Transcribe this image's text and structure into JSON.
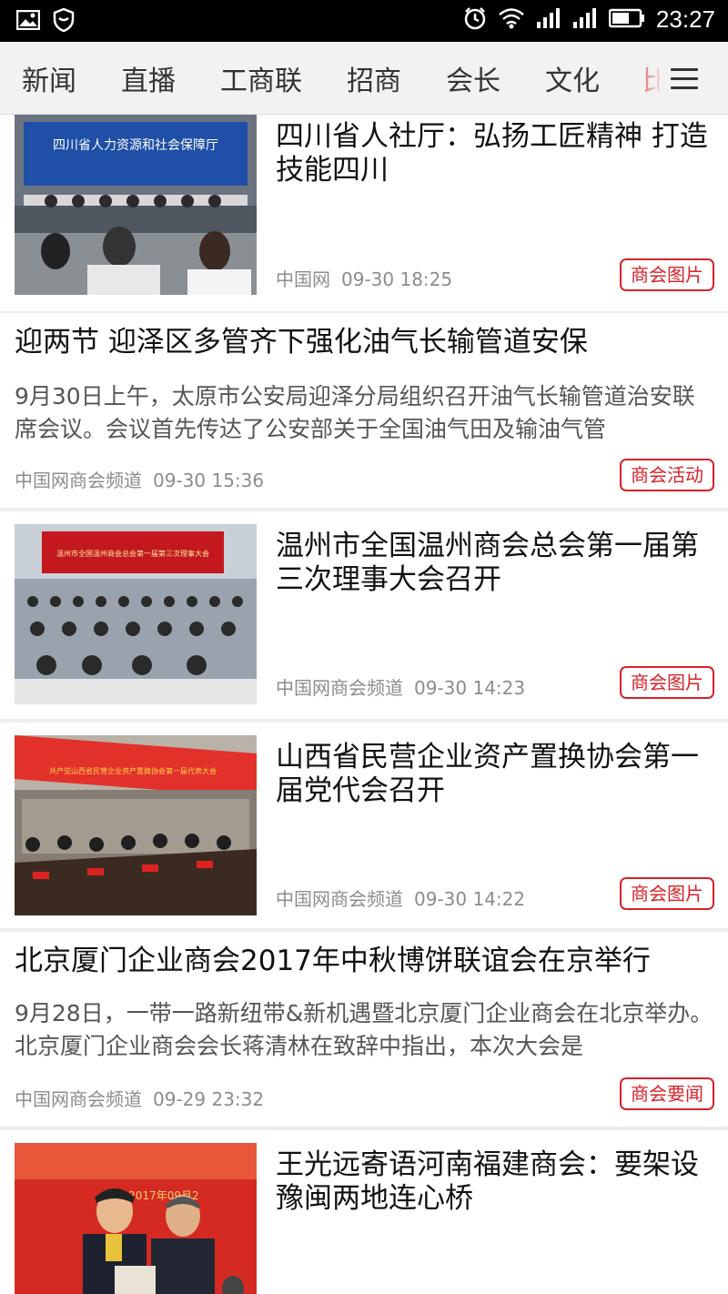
{
  "status_bar": {
    "time": "23:27",
    "icons": [
      "gallery-icon",
      "shield-icon",
      "alarm-icon",
      "wifi-icon",
      "signal-icon",
      "signal-icon",
      "battery-icon"
    ]
  },
  "nav": {
    "tabs": [
      "新闻",
      "直播",
      "工商联",
      "招商",
      "会长",
      "文化"
    ],
    "overflow_tab": "比",
    "menu_icon": "hamburger-menu-icon",
    "accent_color": "#d8222a"
  },
  "feed": [
    {
      "type": "image",
      "title": "四川省人社厅：弘扬工匠精神 打造技能四川",
      "source": "中国网",
      "time": "09-30 18:25",
      "tag": "商会图片",
      "image_caption": "四川省人力资源和社会保障厅"
    },
    {
      "type": "text",
      "title": "迎两节 迎泽区多管齐下强化油气长输管道安保",
      "summary": "9月30日上午，太原市公安局迎泽分局组织召开油气长输管道治安联席会议。会议首先传达了公安部关于全国油气田及输油气管",
      "source": "中国网商会频道",
      "time": "09-30 15:36",
      "tag": "商会活动"
    },
    {
      "type": "image",
      "title": "温州市全国温州商会总会第一届第三次理事大会召开",
      "source": "中国网商会频道",
      "time": "09-30 14:23",
      "tag": "商会图片",
      "image_caption": "温州市全国温州商会总会第一届第三次理事大会"
    },
    {
      "type": "image",
      "title": "山西省民营企业资产置换协会第一届党代会召开",
      "source": "中国网商会频道",
      "time": "09-30 14:22",
      "tag": "商会图片",
      "image_caption": "共产党山西省民营企业资产置换协会第一届代表大会"
    },
    {
      "type": "text",
      "title": "北京厦门企业商会2017年中秋博饼联谊会在京举行",
      "summary": "9月28日，一带一路新纽带&新机遇暨北京厦门企业商会在北京举办。北京厦门企业商会会长蒋清林在致辞中指出，本次大会是",
      "source": "中国网商会频道",
      "time": "09-29 23:32",
      "tag": "商会要闻"
    },
    {
      "type": "image",
      "title": "王光远寄语河南福建商会：要架设豫闽两地连心桥",
      "source": "",
      "time": "",
      "tag": "",
      "image_caption": "郑州 2017年09月2"
    }
  ]
}
